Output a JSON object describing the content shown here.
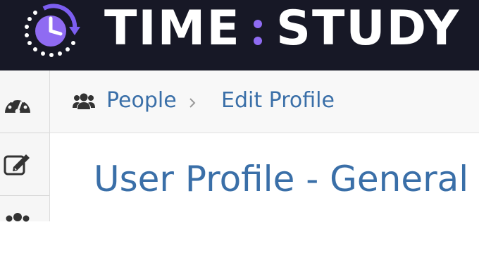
{
  "brand": {
    "left": "TIME",
    "right": "STUDY",
    "accent_color": "#8f6bf2"
  },
  "sidebar": {
    "items": [
      {
        "icon": "dashboard-gauge-icon"
      },
      {
        "icon": "edit-icon"
      },
      {
        "icon": "people-icon"
      }
    ]
  },
  "breadcrumb": {
    "icon": "people-icon",
    "items": [
      "People",
      "Edit Profile"
    ],
    "separator_icon": "chevron-right-icon"
  },
  "main": {
    "title": "User Profile - General -"
  }
}
